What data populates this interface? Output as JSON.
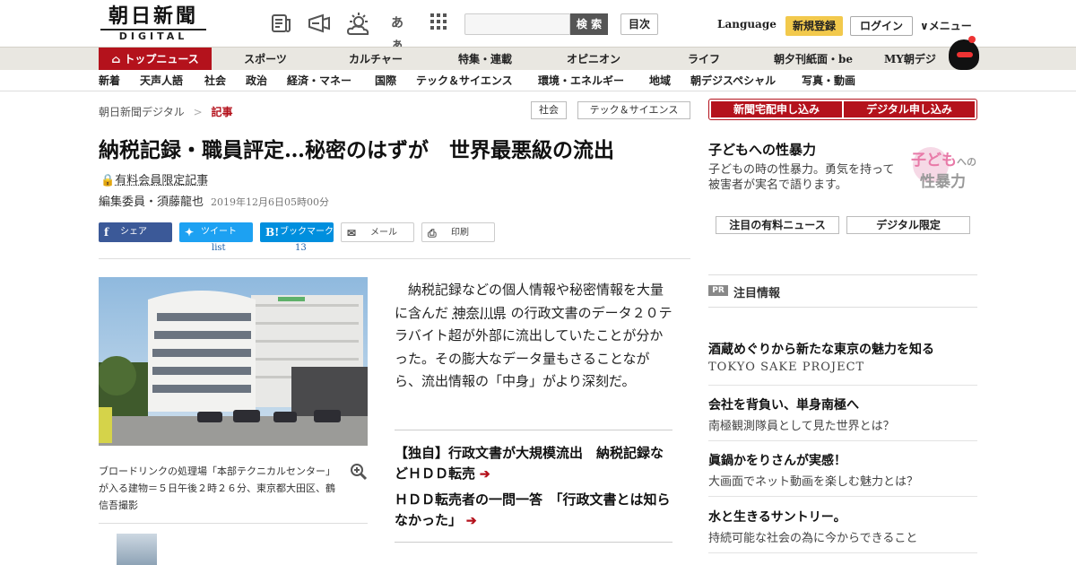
{
  "header": {
    "logo_jp": "朝日新聞",
    "logo_en": "DIGITAL",
    "icons": [
      "newspaper-icon",
      "megaphone-icon",
      "weather-icon",
      "font-size-icon",
      "grid-icon"
    ],
    "font_size_glyph": "あぁ",
    "search_placeholder": "",
    "search_button": "検 索",
    "toc_button": "目次",
    "language": "Language",
    "register": "新規登録",
    "login": "ログイン",
    "menu": "メニュー"
  },
  "nav_main": [
    "トップニュース",
    "スポーツ",
    "カルチャー",
    "特集・連載",
    "オピニオン",
    "ライフ",
    "朝夕刊紙面・be",
    "MY朝デジ"
  ],
  "nav_sub": [
    "新着",
    "天声人語",
    "社会",
    "政治",
    "経済・マネー",
    "国際",
    "テック＆サイエンス",
    "環境・エネルギー",
    "地域",
    "朝デジスペシャル",
    "写真・動画"
  ],
  "breadcrumb": {
    "home": "朝日新聞デジタル",
    "sep": ">",
    "current": "記事"
  },
  "tags": [
    "社会",
    "テック＆サイエンス"
  ],
  "article": {
    "title": "納税記録・職員評定…秘密のはずが　世界最悪級の流出",
    "paid_label": "有料会員限定記事",
    "author": "編集委員・須藤龍也",
    "date": "2019年12月6日05時00分",
    "share": {
      "facebook": "シェア",
      "twitter": "ツイート",
      "hatena": "ブックマーク",
      "mail": "メール",
      "print": "印刷",
      "twitter_count": "list",
      "hatena_count": "13"
    },
    "caption": "ブロードリンクの処理場「本部テクニカルセンター」が入る建物＝５日午後２時２６分、東京都大田区、鶴信吾撮影",
    "body_before": "納税記録などの個人情報や秘密情報を大量に含んだ",
    "body_link": "神奈川県",
    "body_after": "の行政文書のデータ２０テラバイト超が外部に流出していたことが分かった。その膨大なデータ量もさることながら、流出情報の「中身」がより深刻だ。",
    "related": [
      "【独自】行政文書が大規模流出　納税記録などＨＤＤ転売",
      "ＨＤＤ転売者の一問一答　「行政文書とは知らなかった」"
    ]
  },
  "sidebar": {
    "subscribe_home": "新聞宅配申し込み",
    "subscribe_digital": "デジタル申し込み",
    "ad_title": "子どもへの性暴力",
    "ad_text": "子どもの時の性暴力。勇気を持って被害者が実名で語ります。",
    "ad_logo_line1": "子ども",
    "ad_logo_small": "への",
    "ad_logo_line2": "性暴力",
    "pill_paid": "注目の有料ニュース",
    "pill_digital": "デジタル限定",
    "pr_badge": "PR",
    "pr_label": "注目情報",
    "pr_items": [
      {
        "title": "酒蔵めぐりから新たな東京の魅力を知る",
        "sub": "TOKYO SAKE PROJECT"
      },
      {
        "title": "会社を背負い、単身南極へ",
        "sub": "南極観測隊員として見た世界とは？"
      },
      {
        "title": "眞鍋かをりさんが実感！",
        "sub": "大画面でネット動画を楽しむ魅力とは？"
      },
      {
        "title": "水と生きるサントリー。",
        "sub": "持続可能な社会の為に今からできること"
      }
    ]
  },
  "colors": {
    "brand_red": "#b4121c",
    "register_yellow": "#f2c94c",
    "facebook": "#3b5998",
    "twitter": "#1da1f2",
    "hatena": "#008fde"
  }
}
